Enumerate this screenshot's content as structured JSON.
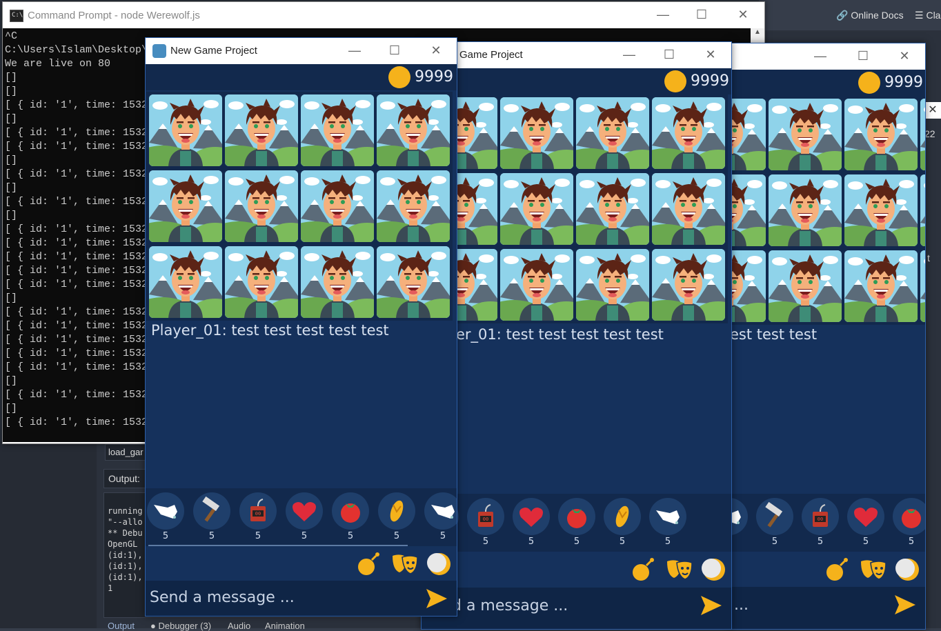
{
  "editor": {
    "online_docs": "Online Docs",
    "class_btn": "Cla",
    "load_game": "load_gar",
    "output_label": "Output:",
    "output_lines": "running\n\"--allo\n** Debu\nOpenGL\n(id:1),\n(id:1),\n(id:1),\n1",
    "tabs": [
      "Output",
      "Debugger (3)",
      "Audio",
      "Animation"
    ],
    "side_letters": [
      "22",
      "t"
    ]
  },
  "cmd": {
    "title": "Command Prompt - node  Werewolf.js",
    "lines": "^C\nC:\\Users\\Islam\\Desktop\\\nWe are live on 80\n[]\n[]\n[ { id: '1', time: 1532\n[]\n[ { id: '1', time: 1532\n[ { id: '1', time: 1532\n[]\n[ { id: '1', time: 1532\n[]\n[ { id: '1', time: 1532\n[]\n[ { id: '1', time: 1532\n[ { id: '1', time: 1532\n[ { id: '1', time: 1532\n[ { id: '1', time: 1532\n[ { id: '1', time: 1532\n[]\n[ { id: '1', time: 1532\n[ { id: '1', time: 1532\n[ { id: '1', time: 1532\n[ { id: '1', time: 1532\n[ { id: '1', time: 1532\n[]\n[ { id: '1', time: 1532\n[]\n[ { id: '1', time: 1532"
  },
  "game": {
    "title": "New Game Project",
    "title_partial": "w Game Project",
    "coins": "9999",
    "chat_line": "Player_01: test test test test test",
    "chat_partial_2": "er_01: test test test test test",
    "chat_partial_3": "est test test",
    "send_placeholder": "Send a message ...",
    "send_partial_2": "d a message ...",
    "send_partial_3": "...",
    "tool_count": "5",
    "tools": [
      "glove-icon",
      "hammer-icon",
      "dynamite-icon",
      "heart-icon",
      "tomato-icon",
      "flipflop-icon",
      "glove-icon"
    ],
    "actions": [
      "bomb-icon",
      "masks-icon",
      "moon-icon"
    ]
  },
  "colors": {
    "game_bg": "#15315c",
    "accent": "#f5b21b",
    "cmd_bg": "#0c0c0c"
  }
}
